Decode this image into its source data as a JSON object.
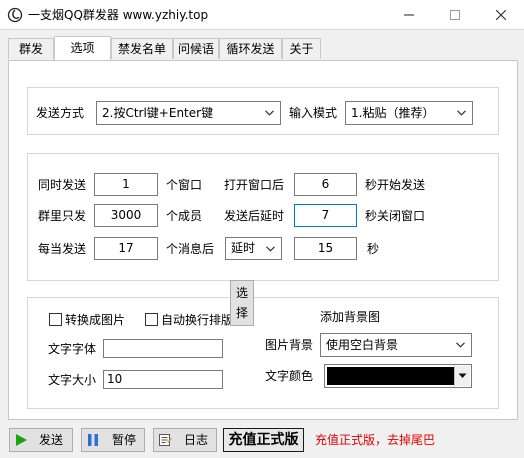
{
  "window": {
    "title": "一支烟QQ群发器 www.yzhiy.top"
  },
  "tabs": [
    {
      "label": "群发",
      "active": false
    },
    {
      "label": "选项",
      "active": true
    },
    {
      "label": "禁发名单",
      "active": false
    },
    {
      "label": "问候语",
      "active": false
    },
    {
      "label": "循环发送",
      "active": false
    },
    {
      "label": "关于",
      "active": false
    }
  ],
  "send_settings": {
    "send_method_label": "发送方式",
    "send_method_value": "2.按Ctrl键+Enter键",
    "input_mode_label": "输入模式",
    "input_mode_value": "1.粘贴（推荐）"
  },
  "timing": {
    "simultaneous_label": "同时发送",
    "simultaneous_value": "1",
    "simultaneous_unit": "个窗口",
    "open_window_label": "打开窗口后",
    "open_window_value": "6",
    "open_window_unit": "秒开始发送",
    "group_only_label": "群里只发",
    "group_only_value": "3000",
    "group_only_unit": "个成员",
    "delay_after_send_label": "发送后延时",
    "delay_after_send_value": "7",
    "delay_after_send_unit": "秒关闭窗口",
    "every_send_label": "每当发送",
    "every_send_value": "17",
    "every_send_unit": "个消息后",
    "after_action_value": "延时",
    "after_seconds_value": "15",
    "after_seconds_unit": "秒"
  },
  "image_options": {
    "convert_to_image_label": "转换成图片",
    "convert_to_image_checked": false,
    "auto_wrap_label": "自动换行排版",
    "auto_wrap_checked": false,
    "add_background_label": "添加背景图",
    "font_label": "文字字体",
    "font_value": "",
    "choose_button_label": "选择",
    "size_label": "文字大小",
    "size_value": "10",
    "background_label": "图片背景",
    "background_value": "使用空白背景",
    "color_label": "文字颜色",
    "text_color": "#000000"
  },
  "footer": {
    "send_button": "发送",
    "pause_button": "暂停",
    "log_button": "日志",
    "vip_button": "充值正式版",
    "promo_text": "充值正式版，去掉尾巴",
    "promo_color": "#e00000"
  },
  "icons": {
    "app": "app-logo-icon",
    "minimize": "minimize-icon",
    "maximize": "maximize-icon",
    "close": "close-icon",
    "send": "play-icon",
    "pause": "pause-icon",
    "log": "log-icon",
    "dropdown": "chevron-down-icon"
  }
}
